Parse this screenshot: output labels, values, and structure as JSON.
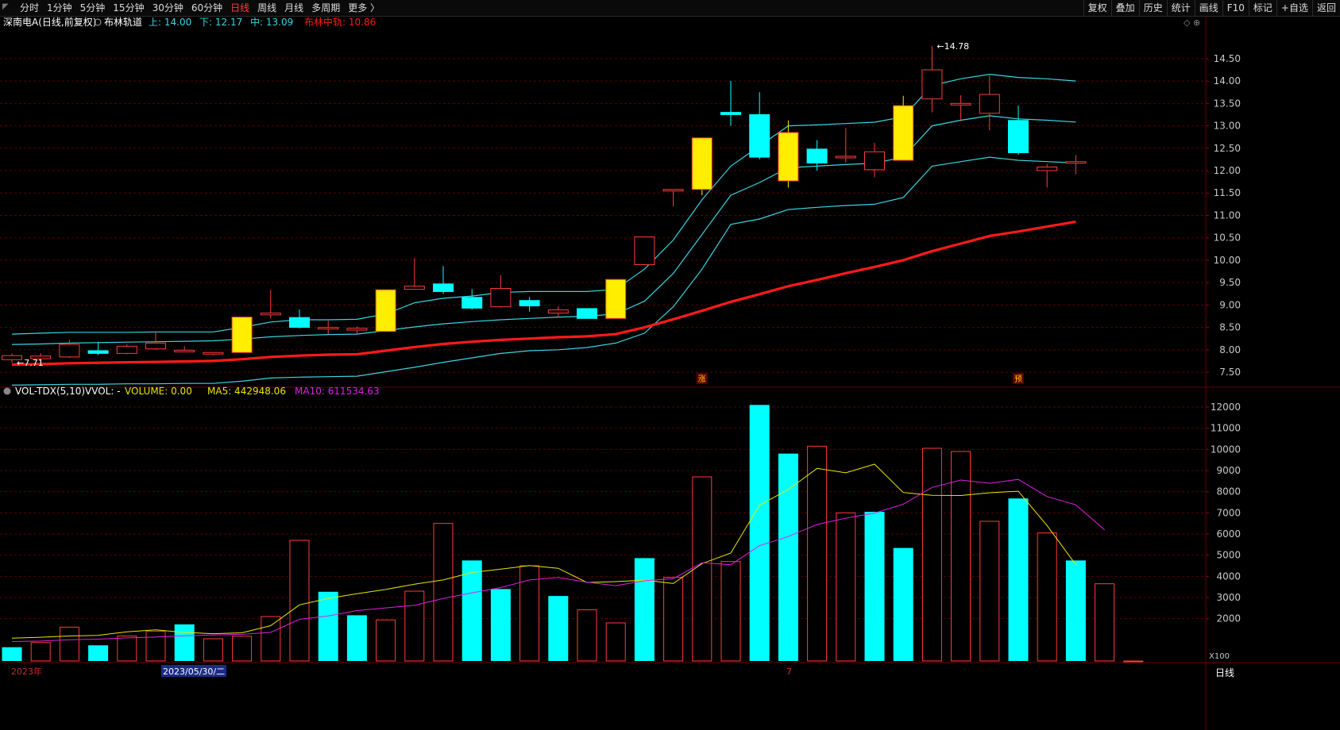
{
  "toolbar": {
    "tabs": [
      "分时",
      "1分钟",
      "5分钟",
      "15分钟",
      "30分钟",
      "60分钟",
      "日线",
      "周线",
      "月线",
      "多周期",
      "更多 〉"
    ],
    "active_tab": "日线",
    "tools": [
      "复权",
      "叠加",
      "历史",
      "统计",
      "画线",
      "F10",
      "标记",
      "+自选",
      "返回"
    ]
  },
  "colors": {
    "background": "#000000",
    "up": "#ff3b3b",
    "down": "#00ffff",
    "limit_up": "#ffee00",
    "boll_band": "#39d5e0",
    "boll_mid": "#ff1a1a",
    "ma5": "#e8e800",
    "ma10": "#e020e0",
    "grid": "#5a0000",
    "axis_text": "#c8c8c8"
  },
  "chart_data": [
    {
      "type": "candlestick",
      "title": "深南电A(日线,前复权)",
      "indicator": {
        "name": "布林轨道",
        "upper_label": "上:",
        "upper_value": "14.00",
        "lower_label": "下:",
        "lower_value": "12.17",
        "middle_label": "中:",
        "middle_value": "13.09",
        "mid_rail_label": "布林中轨:",
        "mid_rail_value": "10.86"
      },
      "y_ticks": [
        "14.50",
        "14.00",
        "13.50",
        "13.00",
        "12.50",
        "12.00",
        "11.50",
        "11.00",
        "10.50",
        "10.00",
        "9.50",
        "9.00",
        "8.50",
        "8.00",
        "7.50"
      ],
      "ylim": [
        7.2,
        15.1
      ],
      "candles": [
        {
          "o": 7.78,
          "h": 7.92,
          "l": 7.71,
          "c": 7.87
        },
        {
          "o": 7.8,
          "h": 7.93,
          "l": 7.73,
          "c": 7.86
        },
        {
          "o": 7.84,
          "h": 8.22,
          "l": 7.82,
          "c": 8.12
        },
        {
          "o": 7.98,
          "h": 8.18,
          "l": 7.88,
          "c": 7.92
        },
        {
          "o": 7.92,
          "h": 8.12,
          "l": 7.9,
          "c": 8.08
        },
        {
          "o": 8.02,
          "h": 8.4,
          "l": 8.0,
          "c": 8.15
        },
        {
          "o": 7.97,
          "h": 8.08,
          "l": 7.95,
          "c": 7.99
        },
        {
          "o": 7.91,
          "h": 7.94,
          "l": 7.88,
          "c": 7.94
        },
        {
          "o": 7.94,
          "h": 8.73,
          "l": 7.94,
          "c": 8.73
        },
        {
          "o": 8.78,
          "h": 9.34,
          "l": 8.7,
          "c": 8.82
        },
        {
          "o": 8.72,
          "h": 8.9,
          "l": 8.48,
          "c": 8.5
        },
        {
          "o": 8.5,
          "h": 8.65,
          "l": 8.35,
          "c": 8.5
        },
        {
          "o": 8.44,
          "h": 8.52,
          "l": 8.36,
          "c": 8.48
        },
        {
          "o": 8.41,
          "h": 9.34,
          "l": 8.41,
          "c": 9.34
        },
        {
          "o": 9.35,
          "h": 10.05,
          "l": 9.35,
          "c": 9.42
        },
        {
          "o": 9.47,
          "h": 9.87,
          "l": 9.25,
          "c": 9.3
        },
        {
          "o": 9.17,
          "h": 9.35,
          "l": 8.9,
          "c": 8.93
        },
        {
          "o": 8.96,
          "h": 9.67,
          "l": 8.94,
          "c": 9.37
        },
        {
          "o": 9.1,
          "h": 9.18,
          "l": 8.85,
          "c": 8.98
        },
        {
          "o": 8.82,
          "h": 8.97,
          "l": 8.72,
          "c": 8.89
        },
        {
          "o": 8.92,
          "h": 8.92,
          "l": 8.7,
          "c": 8.7
        },
        {
          "o": 8.7,
          "h": 9.57,
          "l": 8.7,
          "c": 9.57
        },
        {
          "o": 9.9,
          "h": 10.52,
          "l": 9.9,
          "c": 10.52
        },
        {
          "o": 11.57,
          "h": 11.57,
          "l": 11.2,
          "c": 11.58
        },
        {
          "o": 11.58,
          "h": 12.73,
          "l": 11.45,
          "c": 12.73
        },
        {
          "o": 13.3,
          "h": 14.0,
          "l": 13.0,
          "c": 13.25
        },
        {
          "o": 13.25,
          "h": 13.75,
          "l": 12.25,
          "c": 12.3
        },
        {
          "o": 11.77,
          "h": 13.12,
          "l": 11.62,
          "c": 12.85
        },
        {
          "o": 12.48,
          "h": 12.68,
          "l": 12.0,
          "c": 12.17
        },
        {
          "o": 12.3,
          "h": 12.95,
          "l": 12.18,
          "c": 12.32
        },
        {
          "o": 12.02,
          "h": 12.62,
          "l": 11.85,
          "c": 12.42
        },
        {
          "o": 12.23,
          "h": 13.67,
          "l": 12.23,
          "c": 13.45
        },
        {
          "o": 13.6,
          "h": 14.78,
          "l": 13.3,
          "c": 14.25
        },
        {
          "o": 13.5,
          "h": 13.68,
          "l": 13.1,
          "c": 13.5
        },
        {
          "o": 13.28,
          "h": 14.12,
          "l": 12.9,
          "c": 13.7
        },
        {
          "o": 13.12,
          "h": 13.45,
          "l": 12.35,
          "c": 12.4
        },
        {
          "o": 12.0,
          "h": 12.15,
          "l": 11.62,
          "c": 12.08
        },
        {
          "o": 12.18,
          "h": 12.35,
          "l": 11.92,
          "c": 12.2
        }
      ],
      "boll_upper": [
        8.35,
        8.37,
        8.39,
        8.39,
        8.39,
        8.4,
        8.4,
        8.4,
        8.5,
        8.62,
        8.67,
        8.67,
        8.68,
        8.8,
        9.05,
        9.15,
        9.2,
        9.28,
        9.3,
        9.3,
        9.3,
        9.35,
        9.8,
        10.45,
        11.35,
        12.1,
        12.55,
        13.0,
        13.02,
        13.05,
        13.08,
        13.2,
        13.9,
        14.05,
        14.15,
        14.08,
        14.05,
        14.0
      ],
      "boll_mid": [
        7.67,
        7.68,
        7.7,
        7.71,
        7.72,
        7.73,
        7.74,
        7.75,
        7.79,
        7.84,
        7.87,
        7.89,
        7.9,
        7.98,
        8.06,
        8.13,
        8.18,
        8.22,
        8.25,
        8.28,
        8.3,
        8.35,
        8.5,
        8.68,
        8.87,
        9.07,
        9.24,
        9.42,
        9.56,
        9.71,
        9.85,
        10.0,
        10.2,
        10.37,
        10.54,
        10.64,
        10.75,
        10.86
      ],
      "boll_lower": [
        7.21,
        7.22,
        7.23,
        7.23,
        7.24,
        7.24,
        7.25,
        7.25,
        7.3,
        7.37,
        7.39,
        7.4,
        7.41,
        7.51,
        7.61,
        7.72,
        7.82,
        7.92,
        7.98,
        8.0,
        8.05,
        8.15,
        8.37,
        8.96,
        9.8,
        10.8,
        10.92,
        11.13,
        11.18,
        11.22,
        11.25,
        11.4,
        12.1,
        12.2,
        12.3,
        12.23,
        12.2,
        12.17
      ],
      "annotations": [
        {
          "label": "14.78",
          "candle": 32,
          "price": 14.78
        },
        {
          "label": "7.71",
          "candle": 0,
          "price": 7.71
        }
      ],
      "markers": [
        {
          "label": "涨",
          "candle": 24
        },
        {
          "label": "预",
          "candle": 35
        }
      ]
    },
    {
      "type": "bar",
      "title": "VOL-TDX(5,10)",
      "legend": {
        "vvol_label": "VVOL: -",
        "volume_label": "VOLUME: 0.00",
        "ma5_label": "MA5: 442948.06",
        "ma10_label": "MA10: 611534.63"
      },
      "unit_label": "X100",
      "y_ticks": [
        "12000",
        "11000",
        "10000",
        "9000",
        "8000",
        "7000",
        "6000",
        "5000",
        "4000",
        "3000",
        "2000"
      ],
      "ylim": [
        0,
        12300
      ],
      "volumes": [
        650,
        870,
        1600,
        740,
        1180,
        1400,
        1730,
        1050,
        1170,
        2100,
        5700,
        3270,
        2160,
        1940,
        3300,
        6500,
        4750,
        3400,
        4500,
        3070,
        2420,
        1800,
        4860,
        3950,
        8700,
        4700,
        12100,
        9800,
        10150,
        7000,
        7050,
        5340,
        10050,
        9900,
        6600,
        7680,
        6050,
        4750,
        3650,
        0
      ],
      "down_bars": [
        0,
        3,
        6,
        11,
        12,
        16,
        17,
        19,
        22,
        26,
        27,
        30,
        31,
        35,
        37
      ],
      "ma5": [
        1080,
        1120,
        1180,
        1210,
        1380,
        1470,
        1350,
        1290,
        1330,
        1670,
        2650,
        2960,
        3180,
        3380,
        3630,
        3830,
        4180,
        4340,
        4510,
        4380,
        3710,
        3750,
        3820,
        3660,
        4600,
        5100,
        7360,
        8100,
        9100,
        8890,
        9300,
        7960,
        7830,
        7820,
        7950,
        8020,
        6400,
        4550
      ],
      "ma10": [
        920,
        940,
        1000,
        1030,
        1090,
        1130,
        1190,
        1230,
        1260,
        1350,
        1970,
        2130,
        2380,
        2510,
        2630,
        2950,
        3220,
        3470,
        3830,
        3950,
        3720,
        3560,
        3790,
        3890,
        4640,
        4550,
        5450,
        5880,
        6450,
        6750,
        6990,
        7410,
        8200,
        8550,
        8400,
        8580,
        7770,
        7380,
        6200
      ]
    }
  ],
  "x_labels": [
    {
      "text": "2023年",
      "highlight": false
    },
    {
      "text": "2023/05/30/二",
      "highlight": true
    },
    {
      "text": "7",
      "highlight": false
    }
  ],
  "footer_label": "日线"
}
